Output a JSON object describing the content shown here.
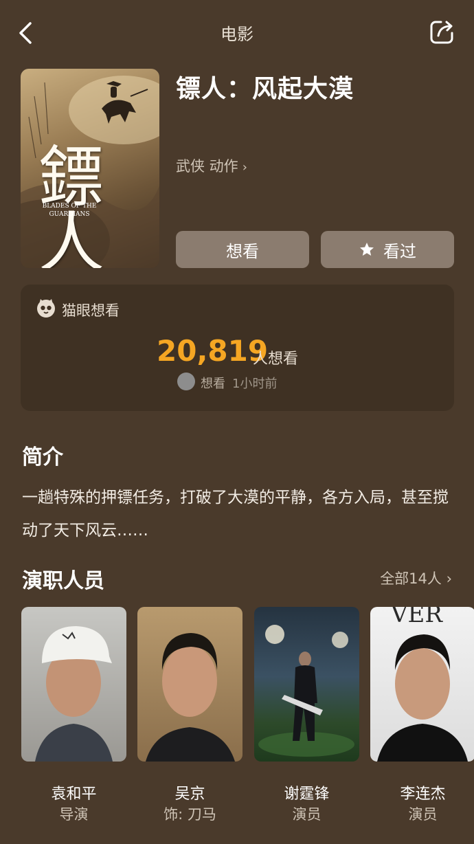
{
  "header": {
    "title": "电影"
  },
  "poster": {
    "title_glyph": "鏢人",
    "subtitle": "BLADES OF THE GUARDIANS"
  },
  "movie": {
    "title": "镖人：风起大漠",
    "genres": "武侠 动作",
    "want_button": "想看",
    "seen_button": "看过"
  },
  "want_card": {
    "label": "猫眼想看",
    "count": "20,819",
    "unit": "人想看",
    "recent_action": "想看",
    "recent_time": "1小时前"
  },
  "intro": {
    "title": "简介",
    "text": "一趟特殊的押镖任务，打破了大漠的平静，各方入局，甚至搅动了天下风云……"
  },
  "cast": {
    "title": "演职人员",
    "all_label": "全部14人",
    "members": [
      {
        "name": "袁和平",
        "role": "导演"
      },
      {
        "name": "吴京",
        "role": "饰: 刀马"
      },
      {
        "name": "谢霆锋",
        "role": "演员"
      },
      {
        "name": "李连杰",
        "role": "演员"
      }
    ]
  },
  "colors": {
    "background": "#4a3a2b",
    "card": "#3f3123",
    "button": "#8b7c6f",
    "accent": "#f5a623"
  }
}
